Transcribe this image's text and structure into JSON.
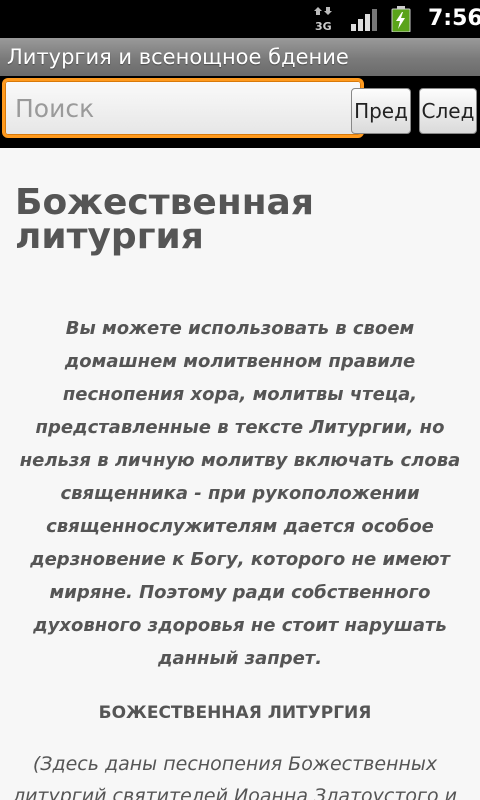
{
  "status_bar": {
    "network": "3G",
    "time": "7:56",
    "icons": [
      "3g-data-icon",
      "signal-strength-icon",
      "battery-charging-icon"
    ]
  },
  "app": {
    "title": "Литургия и всенощное бдение"
  },
  "search": {
    "placeholder": "Поиск",
    "value": "",
    "prev_label": "Пред",
    "next_label": "След"
  },
  "content": {
    "title": "Божественная литургия",
    "intro": "Вы можете использовать в своем домашнем молитвенном правиле песнопения хора, молитвы чтеца, представленные в тексте Литургии, но нельзя в личную молитву включать слова священника - при рукоположении священнослужителям дается особое дерзновение к Богу, которого не имеют миряне. Поэтому ради собственного духовного здоровья не стоит нарушать данный запрет.",
    "section_heading": "БОЖЕСТВЕННАЯ ЛИТУРГИЯ",
    "note": "(Здесь даны песнопения Божественных литургий святителей Иоанна Златоустого и"
  },
  "colors": {
    "focus_border": "#ff9a1e",
    "title_bar": "#7a7a7a",
    "text": "#555555",
    "background": "#f7f7f7"
  }
}
